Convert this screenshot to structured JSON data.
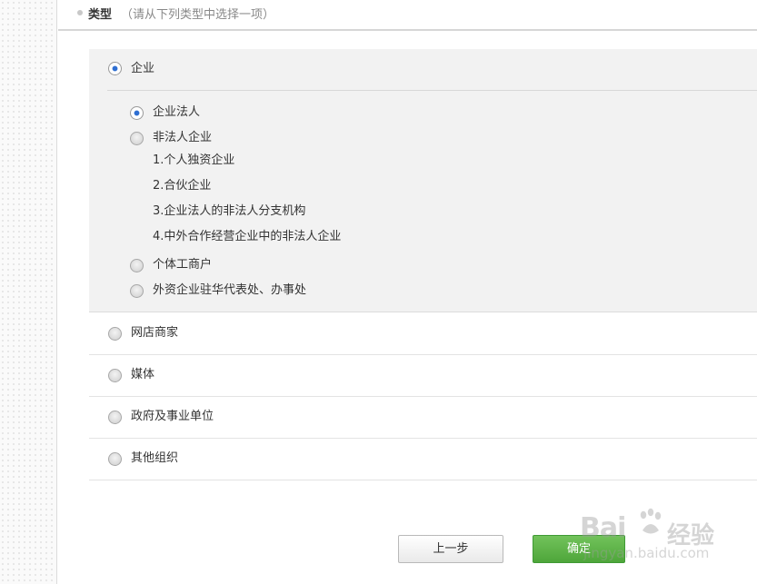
{
  "header": {
    "title": "类型",
    "hint": "（请从下列类型中选择一项）"
  },
  "types": [
    {
      "label": "企业",
      "selected": true
    },
    {
      "label": "网店商家",
      "selected": false
    },
    {
      "label": "媒体",
      "selected": false
    },
    {
      "label": "政府及事业单位",
      "selected": false
    },
    {
      "label": "其他组织",
      "selected": false
    }
  ],
  "enterprise_subtypes": [
    {
      "label": "企业法人",
      "selected": true
    },
    {
      "label": "非法人企业",
      "selected": false
    },
    {
      "label": "个体工商户",
      "selected": false
    },
    {
      "label": "外资企业驻华代表处、办事处",
      "selected": false
    }
  ],
  "non_legal_notes": [
    "1.个人独资企业",
    "2.合伙企业",
    "3.企业法人的非法人分支机构",
    "4.中外合作经营企业中的非法人企业"
  ],
  "buttons": {
    "prev": "上一步",
    "confirm": "确定"
  },
  "watermark": {
    "brand": "Bai",
    "brand_cn": "经验",
    "url": "jingyan.baidu.com"
  },
  "colors": {
    "radio_checked": "#2f6fd2",
    "confirm_button": "#55ab40",
    "block_background": "#f2f2f2"
  }
}
